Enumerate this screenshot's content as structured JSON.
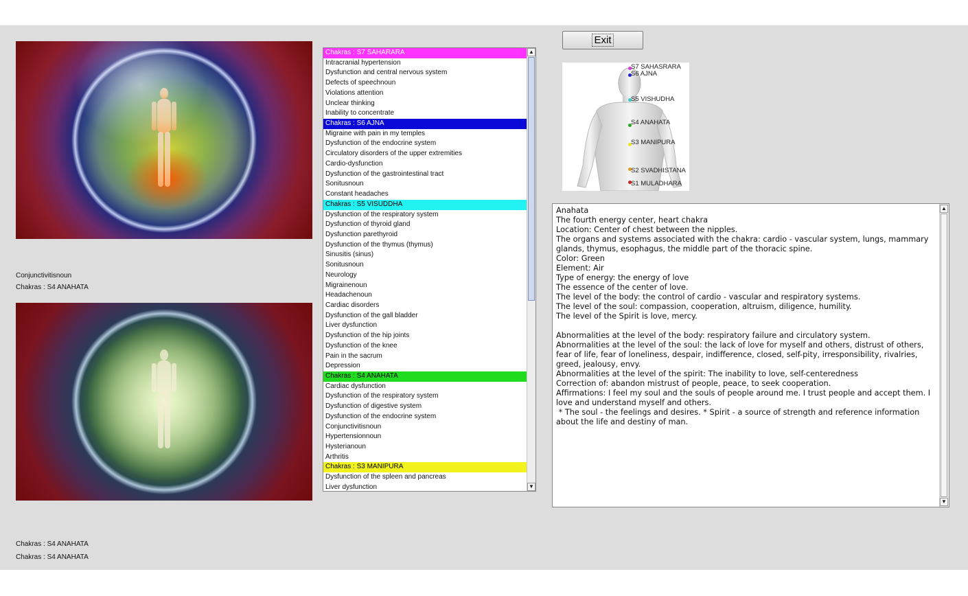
{
  "window": {
    "exit_label": "Exit"
  },
  "status": {
    "top_disease": "Conjunctivitisnoun",
    "top_chakra": "Chakras : S4 ANAHATA",
    "bottom_line1": "Chakras : S4 ANAHATA",
    "bottom_line2": "Chakras : S4 ANAHATA"
  },
  "chakra_list": {
    "scroll_position": 0.0,
    "rows": [
      {
        "text": "Chakras : S7 SAHARARA",
        "header": true,
        "bg": "#ff33ff",
        "fg": "#ffffff"
      },
      {
        "text": "Intracranial hypertension"
      },
      {
        "text": "Dysfunction and central nervous system"
      },
      {
        "text": "Defects of speechnoun"
      },
      {
        "text": "Violations attention"
      },
      {
        "text": "Unclear thinking"
      },
      {
        "text": "Inability to concentrate"
      },
      {
        "text": "Chakras : S6 AJNA",
        "header": true,
        "bg": "#0a0ad8",
        "fg": "#ffffff"
      },
      {
        "text": "Migraine with pain in my temples"
      },
      {
        "text": "Dysfunction of the endocrine system"
      },
      {
        "text": "Circulatory disorders of the upper extremities"
      },
      {
        "text": "Cardio-dysfunction"
      },
      {
        "text": "Dysfunction of the gastrointestinal tract"
      },
      {
        "text": "Sonitusnoun"
      },
      {
        "text": "Constant headaches"
      },
      {
        "text": "Chakras : S5 VISUDDHA",
        "header": true,
        "bg": "#22f2f2",
        "fg": "#000000"
      },
      {
        "text": "Dysfunction of the respiratory system"
      },
      {
        "text": "Dysfunction of thyroid gland"
      },
      {
        "text": "Dysfunction parethyroid"
      },
      {
        "text": "Dysfunction of the thymus (thymus)"
      },
      {
        "text": "Sinusitis (sinus)"
      },
      {
        "text": "Sonitusnoun"
      },
      {
        "text": "Neurology"
      },
      {
        "text": "Migrainenoun"
      },
      {
        "text": "Headachenoun"
      },
      {
        "text": "Cardiac disorders"
      },
      {
        "text": "Dysfunction of the gall bladder"
      },
      {
        "text": "Liver dysfunction"
      },
      {
        "text": "Dysfunction of the hip joints"
      },
      {
        "text": "Dysfunction of the knee"
      },
      {
        "text": "Pain in the sacrum"
      },
      {
        "text": "Depression"
      },
      {
        "text": "Chakras : S4 ANAHATA",
        "header": true,
        "bg": "#1fdc1f",
        "fg": "#000000"
      },
      {
        "text": "Cardiac dysfunction"
      },
      {
        "text": "Dysfunction of the respiratory system"
      },
      {
        "text": "Dysfunction of digestive system"
      },
      {
        "text": "Dysfunction of the endocrine system"
      },
      {
        "text": "Conjunctivitisnoun"
      },
      {
        "text": "Hypertensionnoun"
      },
      {
        "text": "Hysterianoun"
      },
      {
        "text": "Arthritis"
      },
      {
        "text": "Chakras : S3 MANIPURA",
        "header": true,
        "bg": "#f2f21c",
        "fg": "#000000"
      },
      {
        "text": "Dysfunction of the spleen and pancreas"
      },
      {
        "text": "Liver dysfunction"
      }
    ]
  },
  "body_map": {
    "points": [
      {
        "label": "S7 SAHASRARA",
        "color": "#d83cd8"
      },
      {
        "label": "S6 AJNA",
        "color": "#2222cc"
      },
      {
        "label": "S5 VISHUDHA",
        "color": "#33cccc"
      },
      {
        "label": "S4 ANAHATA",
        "color": "#22aa22"
      },
      {
        "label": "S3 MANIPURA",
        "color": "#e6e61a"
      },
      {
        "label": "S2 SVADHISTANA",
        "color": "#e89a1a"
      },
      {
        "label": "S1 MULADHARA",
        "color": "#cc2222"
      }
    ]
  },
  "description": {
    "text": "Anahata\nThe fourth energy center, heart chakra\nLocation: Center of chest between the nipples.\nThe organs and systems associated with the chakra: cardio - vascular system, lungs, mammary glands, thymus, esophagus, the middle part of the thoracic spine.\nColor: Green\nElement: Air\nType of energy: the energy of love\nThe essence of the center of love.\nThe level of the body: the control of cardio - vascular and respiratory systems.\nThe level of the soul: compassion, cooperation, altruism, diligence, humility.\nThe level of the Spirit is love, mercy.\n\nAbnormalities at the level of the body: respiratory failure and circulatory system.\nAbnormalities at the level of the soul: the lack of love for myself and others, distrust of others, fear of life, fear of loneliness, despair, indifference, closed, self-pity, irresponsibility, rivalries, greed, jealousy, envy.\nAbnormalities at the level of the spirit: The inability to love, self-centeredness\nCorrection of: abandon mistrust of people, peace, to seek cooperation.\nAffirmations: I feel my soul and the souls of people around me. I trust people and accept them. I love and understand myself and others.\n * The soul - the feelings and desires. * Spirit - a source of strength and reference information about the life and destiny of man."
  }
}
